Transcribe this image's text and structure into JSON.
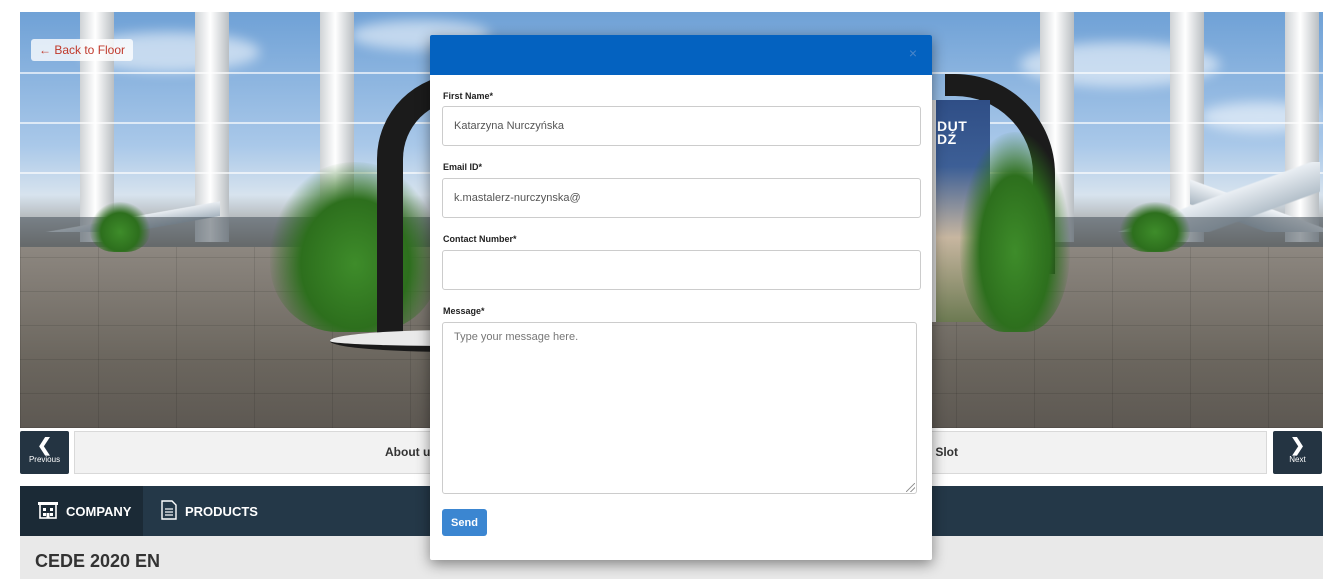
{
  "floor": {
    "back_label": "← Back to Floor",
    "poster_text": "DUT\nDŹ"
  },
  "nav": {
    "previous_label": "Previous",
    "next_label": "Next",
    "about_label": "About u",
    "slot_label": ": Slot"
  },
  "tabs": [
    {
      "label": "COMPANY",
      "icon": "building-icon",
      "active": true
    },
    {
      "label": "PRODUCTS",
      "icon": "document-icon",
      "active": false
    }
  ],
  "company": {
    "name": "CEDE 2020 EN"
  },
  "modal": {
    "close_glyph": "×",
    "fields": {
      "first_name_label": "First Name*",
      "first_name_value": "Katarzyna Nurczyńska",
      "email_label": "Email ID*",
      "email_value": "k.mastalerz-nurczynska@",
      "contact_label": "Contact Number*",
      "contact_value": "",
      "message_label": "Message*",
      "message_placeholder": "Type your message here."
    },
    "send_label": "Send"
  },
  "colors": {
    "modal_header": "#0462c0",
    "send_button": "#3b86d1",
    "tab_bar": "#243848",
    "back_link": "#c0392b"
  }
}
